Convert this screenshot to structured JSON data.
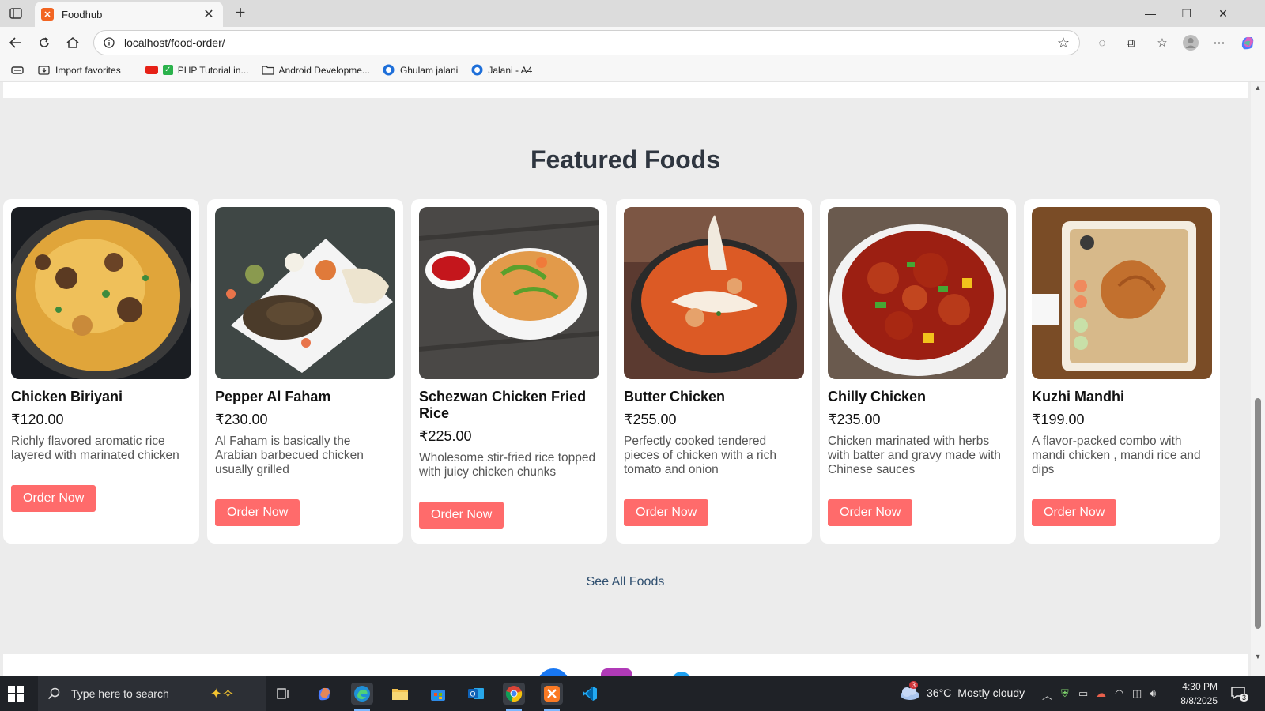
{
  "browser": {
    "tab_title": "Foodhub",
    "url": "localhost/food-order/",
    "favorites": [
      {
        "label": "Import favorites",
        "icon": "import-icon"
      },
      {
        "label": "PHP Tutorial in...",
        "icon": "youtube-icon"
      },
      {
        "label": "Android Developme...",
        "icon": "folder-icon"
      },
      {
        "label": "Ghulam jalani",
        "icon": "profile-icon"
      },
      {
        "label": "Jalani - A4",
        "icon": "profile-icon"
      }
    ]
  },
  "page": {
    "section_title": "Featured Foods",
    "see_all": "See All Foods",
    "order_label": "Order Now",
    "foods": [
      {
        "name": "Chicken Biriyani",
        "price": "₹120.00",
        "desc": "Richly flavored aromatic rice layered with marinated chicken"
      },
      {
        "name": "Pepper Al Faham",
        "price": "₹230.00",
        "desc": "Al Faham is basically the Arabian barbecued chicken usually grilled"
      },
      {
        "name": "Schezwan Chicken Fried Rice",
        "price": "₹225.00",
        "desc": "Wholesome stir-fried rice topped with juicy chicken chunks"
      },
      {
        "name": "Butter Chicken",
        "price": "₹255.00",
        "desc": "Perfectly cooked tendered pieces of chicken with a rich tomato and onion"
      },
      {
        "name": "Chilly Chicken",
        "price": "₹235.00",
        "desc": "Chicken marinated with herbs with batter and gravy made with Chinese sauces"
      },
      {
        "name": "Kuzhi Mandhi",
        "price": "₹199.00",
        "desc": "A flavor-packed combo with mandi chicken , mandi rice and dips"
      }
    ]
  },
  "taskbar": {
    "search_placeholder": "Type here to search",
    "weather_temp": "36°C",
    "weather_text": "Mostly cloudy",
    "weather_badge": "3",
    "time": "4:30 PM",
    "date": "8/8/2025",
    "notification_count": "3"
  },
  "colors": {
    "accent_button": "#ff6b6b",
    "title_text": "#2f3640",
    "page_bg": "#ececec"
  }
}
